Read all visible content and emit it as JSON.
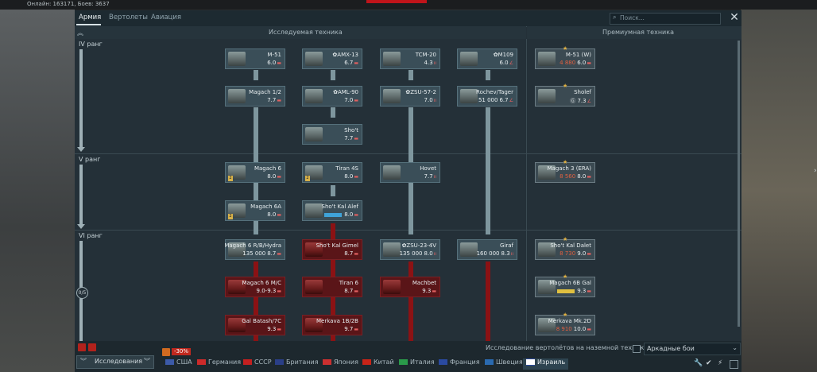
{
  "status": {
    "online_text": "Онлайн: 163171, Боев: 3637"
  },
  "tabs": [
    {
      "label": "Армия",
      "active": true
    },
    {
      "label": "Вертолеты",
      "active": false
    },
    {
      "label": "Авиация",
      "active": false
    }
  ],
  "search": {
    "placeholder": "Поиск..."
  },
  "headers": {
    "researchable": "Исследуемая техника",
    "premium": "Премиумная техника"
  },
  "ranks": [
    {
      "label": "IV ранг"
    },
    {
      "label": "V ранг"
    },
    {
      "label": "VI ранг"
    }
  ],
  "rank_counter": "0/5",
  "vehicles": {
    "m51": {
      "name": "M-51",
      "br": "6.0"
    },
    "amx13": {
      "name": "✿AMX-13",
      "br": "6.7"
    },
    "tcm20": {
      "name": "TCM-20",
      "br": "4.3"
    },
    "m109": {
      "name": "✿M109",
      "br": "6.0"
    },
    "m51w": {
      "name": "M-51 (W)",
      "cost": "4 880",
      "br": "6.0"
    },
    "magach12": {
      "name": "Magach 1/2",
      "br": "7.7"
    },
    "aml90": {
      "name": "✿AML-90",
      "br": "7.0"
    },
    "zsu572": {
      "name": "✿ZSU-57-2",
      "br": "7.0"
    },
    "rochev": {
      "name": "Rochev/Tager",
      "cost": "51 000",
      "br": "6.7"
    },
    "sholef": {
      "name": "Sholef",
      "br": "7.3"
    },
    "shot": {
      "name": "Sho't",
      "br": "7.7"
    },
    "magach6": {
      "name": "Magach 6",
      "br": "8.0"
    },
    "tiran45": {
      "name": "Tiran 4S",
      "br": "8.0"
    },
    "hovet": {
      "name": "Hovet",
      "br": "7.7"
    },
    "magach3era": {
      "name": "Magach 3 (ERA)",
      "cost": "8 560",
      "br": "8.0"
    },
    "magach6a": {
      "name": "Magach 6A",
      "br": "8.0"
    },
    "shotkalalef": {
      "name": "Sho't Kal Alef",
      "br": "8.0"
    },
    "magach6rbh": {
      "name": "Magach 6 R/B/Hydra",
      "cost": "135 000",
      "br": "8.7"
    },
    "shotkalgimel": {
      "name": "Sho't Kal Gimel",
      "br": "8.7"
    },
    "zsu234v": {
      "name": "✿ZSU-23-4V",
      "cost": "135 000",
      "br": "8.0"
    },
    "giraf": {
      "name": "Giraf",
      "cost": "160 000",
      "br": "8.3"
    },
    "shotkaldalet": {
      "name": "Sho't Kal Dalet",
      "cost": "8 730",
      "br": "9.0"
    },
    "magach6mc": {
      "name": "Magach 6 M/C",
      "br": "9.0-9.3"
    },
    "tiran6": {
      "name": "Tiran 6",
      "br": "8.7"
    },
    "machbet": {
      "name": "Machbet",
      "br": "9.3"
    },
    "magach6bgal": {
      "name": "Magach 6B Gal",
      "br": "9.3"
    },
    "galbatash": {
      "name": "Gal Batash/7C",
      "br": "9.3"
    },
    "merkava1b": {
      "name": "Merkava 1B/2B",
      "br": "9.7"
    },
    "merkavamk2d": {
      "name": "Merkava Mk.2D",
      "cost": "8 910",
      "br": "10.0"
    }
  },
  "bottom": {
    "heli_research": "Исследование вертолётов на наземной технике",
    "mode": "Аркадные бои",
    "research_button": "Исследования",
    "discount": "-30%"
  },
  "nations": [
    {
      "name": "США",
      "color": "#3c5aa8"
    },
    {
      "name": "Германия",
      "color": "#cc2a2a"
    },
    {
      "name": "СССР",
      "color": "#c42020"
    },
    {
      "name": "Британия",
      "color": "#2a3f88"
    },
    {
      "name": "Япония",
      "color": "#cc3030"
    },
    {
      "name": "Китай",
      "color": "#c82418"
    },
    {
      "name": "Италия",
      "color": "#2a9a4a"
    },
    {
      "name": "Франция",
      "color": "#2a4aa0"
    },
    {
      "name": "Швеция",
      "color": "#2a6ab0"
    },
    {
      "name": "Израиль",
      "color": "#ffffff",
      "active": true
    }
  ]
}
